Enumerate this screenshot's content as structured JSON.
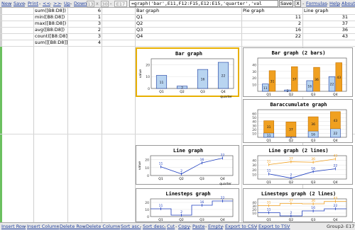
{
  "toolbar": {
    "new": "New",
    "save": "Save",
    "print": "Print",
    "prev": "<<",
    "next": ">>",
    "up": "Up",
    "down": "Down",
    "box_rows": "13",
    "box_x": "x",
    "box_cols": "30",
    "box_cell": "E17",
    "formula": "=graph('bar',E11,F12:F15,E12:E15,'quarter','val",
    "save_btn": "Save",
    "x_btn": "X",
    "formulas": "Formulas",
    "help": "Help",
    "about": "About"
  },
  "table": {
    "headers": [
      "Bar graph",
      "Pie graph",
      "Line graph"
    ],
    "rows": [
      {
        "label": "sum([B8:D8])",
        "value": "6",
        "q": "Q1",
        "pie": "11",
        "line": "31"
      },
      {
        "label": "min([B8:D8])",
        "value": "1",
        "q": "Q2",
        "pie": "2",
        "line": "37"
      },
      {
        "label": "max([B8:D8])",
        "value": "3",
        "q": "Q3",
        "pie": "16",
        "line": "36"
      },
      {
        "label": "avg([B8:D8])",
        "value": "2",
        "q": "Q4",
        "pie": "22",
        "line": "43"
      },
      {
        "label": "count([B8:D8])",
        "value": "3"
      },
      {
        "label": "sum([[B8:D8]])",
        "value": "4"
      }
    ]
  },
  "chart_data": [
    {
      "type": "bar",
      "title": "Bar graph",
      "categories": [
        "Q1",
        "Q2",
        "Q3",
        "Q4"
      ],
      "series": [
        {
          "values": [
            11,
            2,
            16,
            22
          ]
        }
      ],
      "xlabel": "quarter",
      "ylabel": "value",
      "ylim": [
        0,
        25
      ],
      "yticks": [
        "0",
        "10",
        "20"
      ]
    },
    {
      "type": "bar",
      "title": "Bar graph (2 bars)",
      "categories": [
        "Q1",
        "Q2",
        "Q3",
        "Q4"
      ],
      "series": [
        {
          "values": [
            11,
            2,
            16,
            22
          ]
        },
        {
          "values": [
            31,
            37,
            36,
            43
          ]
        }
      ],
      "ylim": [
        0,
        50
      ],
      "yticks": [
        "10",
        "20",
        "30",
        "40"
      ]
    },
    {
      "type": "bar",
      "title": "Baraccumulate graph",
      "categories": [
        "Q1",
        "Q2",
        "Q3",
        "Q4"
      ],
      "series": [
        {
          "values": [
            11,
            2,
            16,
            22
          ]
        },
        {
          "values": [
            31,
            37,
            36,
            43
          ]
        }
      ],
      "ylim": [
        0,
        70
      ],
      "yticks": [
        "10",
        "20",
        "30",
        "40",
        "50",
        "60"
      ]
    },
    {
      "type": "line",
      "title": "Line graph",
      "categories": [
        "Q1",
        "Q2",
        "Q3",
        "Q4"
      ],
      "series": [
        {
          "values": [
            11,
            2,
            16,
            22
          ]
        }
      ],
      "xlabel": "quarter",
      "ylabel": "value",
      "ylim": [
        0,
        25
      ],
      "yticks": [
        "0",
        "10",
        "20"
      ]
    },
    {
      "type": "line",
      "title": "Line graph (2 lines)",
      "categories": [
        "Q1",
        "Q2",
        "Q3",
        "Q4"
      ],
      "series": [
        {
          "values": [
            11,
            2,
            16,
            22
          ]
        },
        {
          "values": [
            31,
            37,
            36,
            43
          ]
        }
      ],
      "ylim": [
        0,
        50
      ],
      "yticks": [
        "10",
        "20",
        "30",
        "40"
      ]
    },
    {
      "type": "line",
      "title": "Linesteps graph",
      "categories": [
        "Q1",
        "Q2",
        "Q3",
        "Q4"
      ],
      "series": [
        {
          "values": [
            11,
            2,
            16,
            22
          ]
        }
      ],
      "ylim": [
        0,
        25
      ],
      "yticks": [
        "0",
        "10",
        "20"
      ]
    },
    {
      "type": "line",
      "title": "Linesteps graph (2 lines)",
      "categories": [
        "Q1",
        "Q2",
        "Q3",
        "Q4"
      ],
      "series": [
        {
          "values": [
            11,
            2,
            16,
            22
          ]
        },
        {
          "values": [
            31,
            37,
            36,
            43
          ]
        }
      ],
      "ylim": [
        0,
        50
      ],
      "yticks": [
        "10",
        "20",
        "30",
        "40"
      ]
    }
  ],
  "status": {
    "insert_row": "Insert Row",
    "insert_column": "Insert Column",
    "delete_row": "Delete Row",
    "delete_column": "Delete Column",
    "sort_asc": "Sort asc.",
    "sort_desc": "Sort desc.",
    "cut": "Cut",
    "copy": "Copy",
    "paste": "Paste",
    "empty": "Empty",
    "export_csv": "Export to CSV",
    "export_tsv": "Export to TSV",
    "group": "Group2",
    "cell_ref": "E17"
  },
  "colors": {
    "blue_fill": "#b8d4f0",
    "blue_stroke": "#1a3aa0",
    "orange_fill": "#f0a020",
    "orange_stroke": "#c07000",
    "line_blue": "#2040c0",
    "line_orange": "#f0a020",
    "selected": "#e8b000"
  }
}
